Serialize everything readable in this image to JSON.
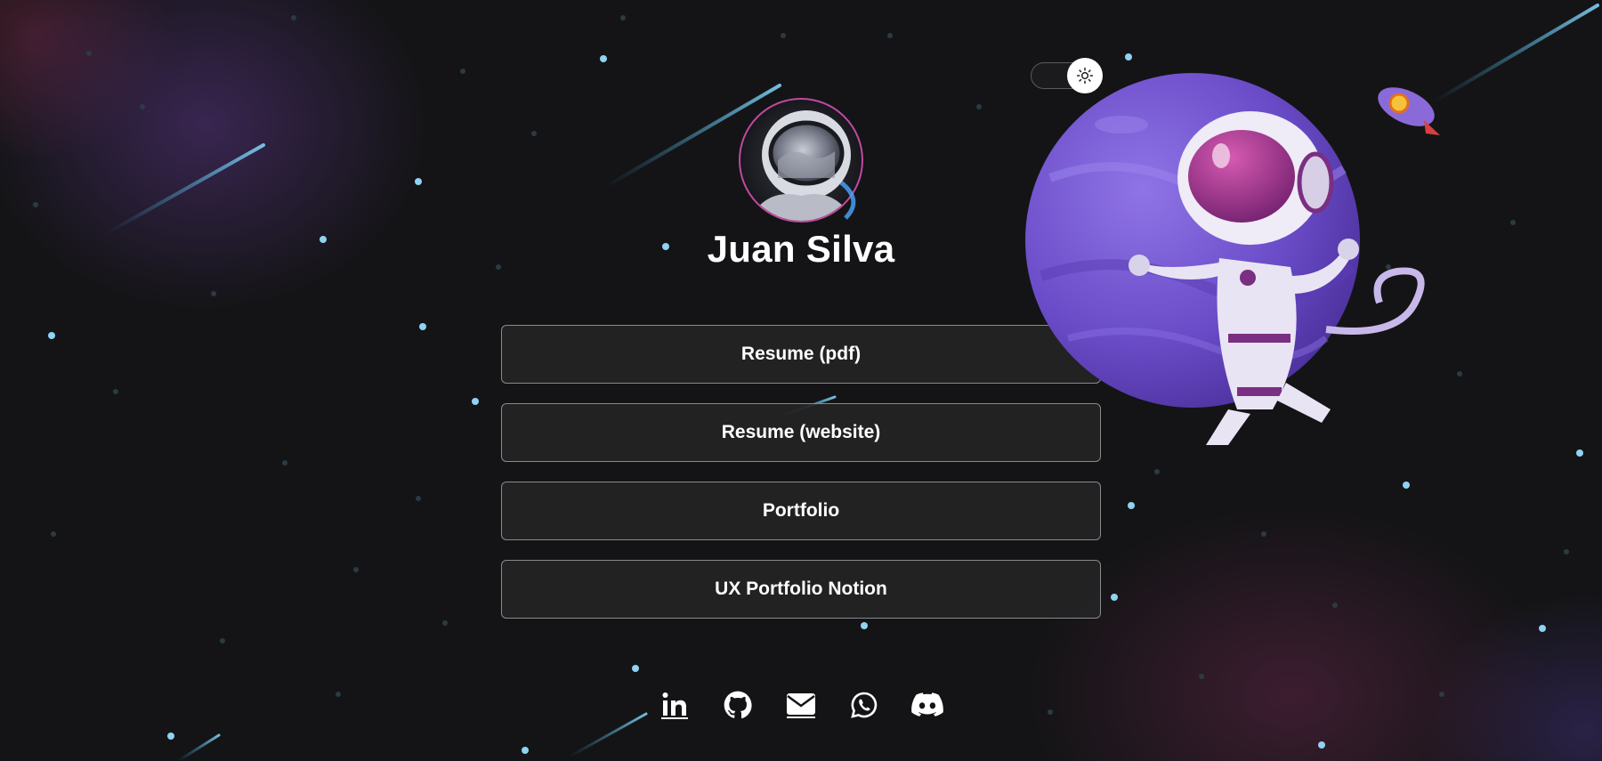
{
  "profile": {
    "name": "Juan Silva"
  },
  "theme_toggle": {
    "icon": "sun-icon"
  },
  "links": [
    {
      "label": "Resume (pdf)"
    },
    {
      "label": "Resume (website)"
    },
    {
      "label": "Portfolio"
    },
    {
      "label": "UX Portfolio Notion"
    }
  ],
  "socials": [
    {
      "icon": "linkedin-icon"
    },
    {
      "icon": "github-icon"
    },
    {
      "icon": "email-icon"
    },
    {
      "icon": "whatsapp-icon"
    },
    {
      "icon": "discord-icon"
    }
  ],
  "colors": {
    "background": "#141416",
    "button_border": "#8a8a8e",
    "button_fill": "#242426",
    "text": "#ffffff",
    "planet": "#7b5cd6",
    "star": "#8fd3f2"
  }
}
